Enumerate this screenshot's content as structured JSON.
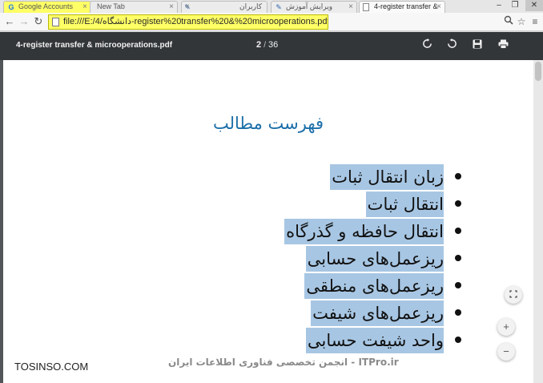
{
  "tabs": [
    {
      "label": "Google Accounts",
      "icon": "google-icon",
      "highlighted": true
    },
    {
      "label": "New Tab",
      "icon": "none"
    },
    {
      "label": "کاربران",
      "icon": "pen-icon"
    },
    {
      "label": "ویرایش آموزش",
      "icon": "pen-icon"
    },
    {
      "label": "4-register transfer &",
      "icon": "page-icon",
      "active": true
    }
  ],
  "window_controls": {
    "minimize": "–",
    "maximize": "❐",
    "close": "✕"
  },
  "address_bar": {
    "url": "file:///E:/4/دانشگاه-register%20transfer%20&%20microoperations.pdf"
  },
  "pdf_toolbar": {
    "filename": "4-register transfer & microoperations.pdf",
    "current_page": "2",
    "separator": "/",
    "total_pages": "36"
  },
  "slide": {
    "title": "فهرست مطالب",
    "bullets": [
      "زبان انتقال ثبات",
      "انتقال ثبات",
      "انتقال حافظه و گذرگاه",
      "ریزعمل‌های حسابی",
      "ریزعمل‌های منطقی",
      "ریزعمل‌های شیفت",
      "واحد شیفت حسابی"
    ],
    "footer": "ITPro.ir - انجمن تخصصی فناوری اطلاعات ایران"
  },
  "watermark": "TOSINSO.COM",
  "colors": {
    "highlight_yellow": "#ffff66",
    "pdf_toolbar": "#323639",
    "selection_blue": "#a7c6e3",
    "title_blue": "#1c6fa9"
  }
}
